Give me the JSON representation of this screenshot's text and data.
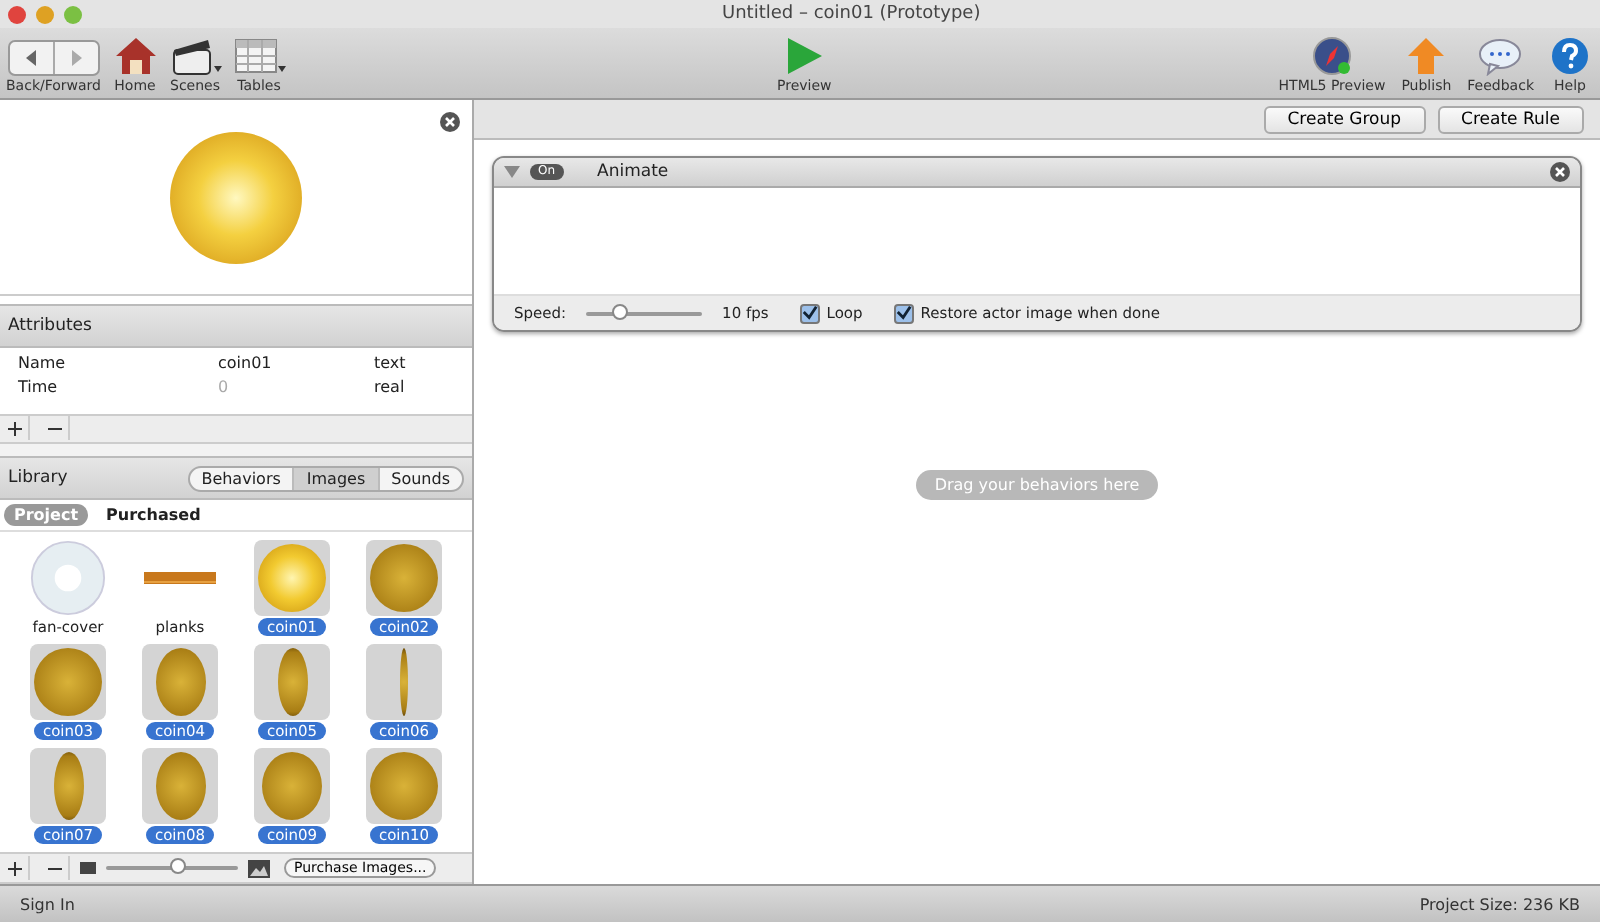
{
  "window": {
    "title": "Untitled – coin01 (Prototype)"
  },
  "toolbar": {
    "left": [
      {
        "kind": "backforward",
        "label": "Back/Forward"
      },
      {
        "kind": "home",
        "label": "Home"
      },
      {
        "kind": "scenes",
        "label": "Scenes"
      },
      {
        "kind": "tables",
        "label": "Tables"
      }
    ],
    "center": {
      "kind": "play",
      "label": "Preview"
    },
    "right": [
      {
        "kind": "compass",
        "label": "HTML5 Preview"
      },
      {
        "kind": "publish",
        "label": "Publish"
      },
      {
        "kind": "feedback",
        "label": "Feedback"
      },
      {
        "kind": "help",
        "label": "Help"
      }
    ]
  },
  "attributes": {
    "title": "Attributes",
    "rows": [
      {
        "name": "Name",
        "value": "coin01",
        "type": "text"
      },
      {
        "name": "Time",
        "value": "0",
        "type": "real"
      }
    ]
  },
  "library": {
    "title": "Library",
    "tabs": [
      {
        "label": "Behaviors",
        "selected": false
      },
      {
        "label": "Images",
        "selected": true
      },
      {
        "label": "Sounds",
        "selected": false
      }
    ],
    "sources": [
      {
        "label": "Project",
        "selected": true
      },
      {
        "label": "Purchased",
        "selected": false
      }
    ],
    "images": [
      {
        "name": "fan-cover",
        "kind": "fan",
        "selected": false
      },
      {
        "name": "planks",
        "kind": "planks",
        "selected": false
      },
      {
        "name": "coin01",
        "kind": "coin-shiny",
        "selected": true
      },
      {
        "name": "coin02",
        "kind": "coin-front",
        "selected": true
      },
      {
        "name": "coin03",
        "kind": "coin-front",
        "selected": true
      },
      {
        "name": "coin04",
        "kind": "coin-tilted",
        "selected": true
      },
      {
        "name": "coin05",
        "kind": "coin-narrow",
        "selected": true
      },
      {
        "name": "coin06",
        "kind": "coin-edge",
        "selected": true
      },
      {
        "name": "coin07",
        "kind": "coin-narrow",
        "selected": true
      },
      {
        "name": "coin08",
        "kind": "coin-tilted",
        "selected": true
      },
      {
        "name": "coin09",
        "kind": "coin-wide",
        "selected": true
      },
      {
        "name": "coin10",
        "kind": "coin-front",
        "selected": true
      }
    ],
    "zoom": {
      "level": 0.55
    },
    "purchase_button": "Purchase Images..."
  },
  "actions": [
    "Create Group",
    "Create Rule"
  ],
  "behavior": {
    "on_label": "On",
    "on": true,
    "expanded": true,
    "title": "Animate",
    "speed_label": "Speed:",
    "speed": {
      "level": 0.3
    },
    "speed_value": "10 fps",
    "options": [
      {
        "label": "Loop",
        "checked": true
      },
      {
        "label": "Restore actor image when done",
        "checked": true
      }
    ]
  },
  "drop_hint": "Drag your behaviors here",
  "status_bar": {
    "left": "Sign In",
    "right": "Project Size: 236 KB"
  }
}
